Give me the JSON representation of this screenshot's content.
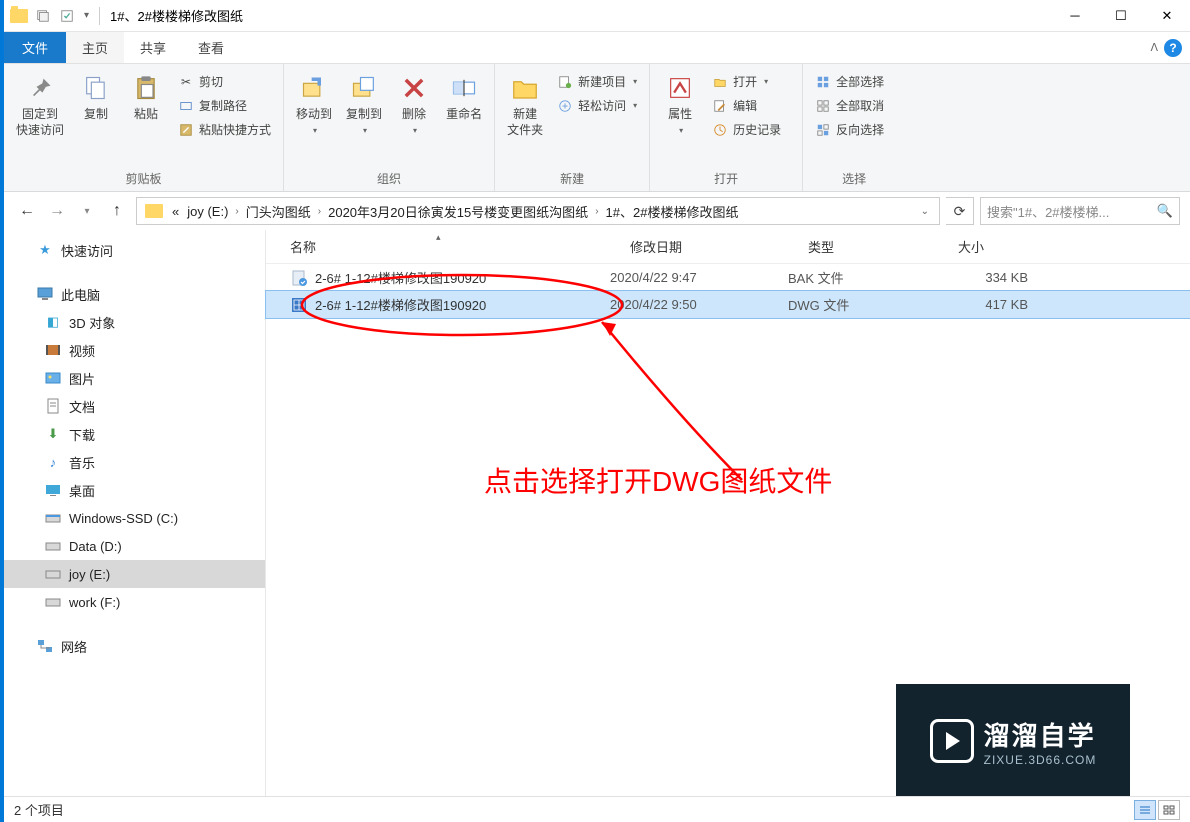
{
  "window": {
    "title": "1#、2#楼楼梯修改图纸"
  },
  "tabs": {
    "file": "文件",
    "home": "主页",
    "share": "共享",
    "view": "查看"
  },
  "ribbon": {
    "clipboard": {
      "label": "剪贴板",
      "pin": "固定到\n快速访问",
      "copy": "复制",
      "paste": "粘贴",
      "cut": "剪切",
      "copypath": "复制路径",
      "pasteshortcut": "粘贴快捷方式"
    },
    "organize": {
      "label": "组织",
      "moveto": "移动到",
      "copyto": "复制到",
      "delete": "删除",
      "rename": "重命名"
    },
    "new": {
      "label": "新建",
      "newfolder": "新建\n文件夹",
      "newitem": "新建项目",
      "easyaccess": "轻松访问"
    },
    "open": {
      "label": "打开",
      "properties": "属性",
      "open": "打开",
      "edit": "编辑",
      "history": "历史记录"
    },
    "select": {
      "label": "选择",
      "selectall": "全部选择",
      "selectnone": "全部取消",
      "invert": "反向选择"
    }
  },
  "breadcrumbs": {
    "root": "«",
    "items": [
      "joy (E:)",
      "门头沟图纸",
      "2020年3月20日徐寅发15号楼变更图纸沟图纸",
      "1#、2#楼楼梯修改图纸"
    ]
  },
  "search": {
    "placeholder": "搜索\"1#、2#楼楼梯..."
  },
  "tree": {
    "quickaccess": "快速访问",
    "thispc": "此电脑",
    "items": [
      "3D 对象",
      "视频",
      "图片",
      "文档",
      "下载",
      "音乐",
      "桌面",
      "Windows-SSD (C:)",
      "Data (D:)",
      "joy (E:)",
      "work (F:)"
    ],
    "network": "网络"
  },
  "columns": {
    "name": "名称",
    "date": "修改日期",
    "type": "类型",
    "size": "大小"
  },
  "files": [
    {
      "name": "2-6# 1-12#楼梯修改图190920",
      "date": "2020/4/22 9:47",
      "type": "BAK 文件",
      "size": "334 KB"
    },
    {
      "name": "2-6# 1-12#楼梯修改图190920",
      "date": "2020/4/22 9:50",
      "type": "DWG 文件",
      "size": "417 KB"
    }
  ],
  "annotation": {
    "text": "点击选择打开DWG图纸文件"
  },
  "status": {
    "count": "2 个项目"
  },
  "watermark": {
    "main": "溜溜自学",
    "sub": "ZIXUE.3D66.COM"
  }
}
